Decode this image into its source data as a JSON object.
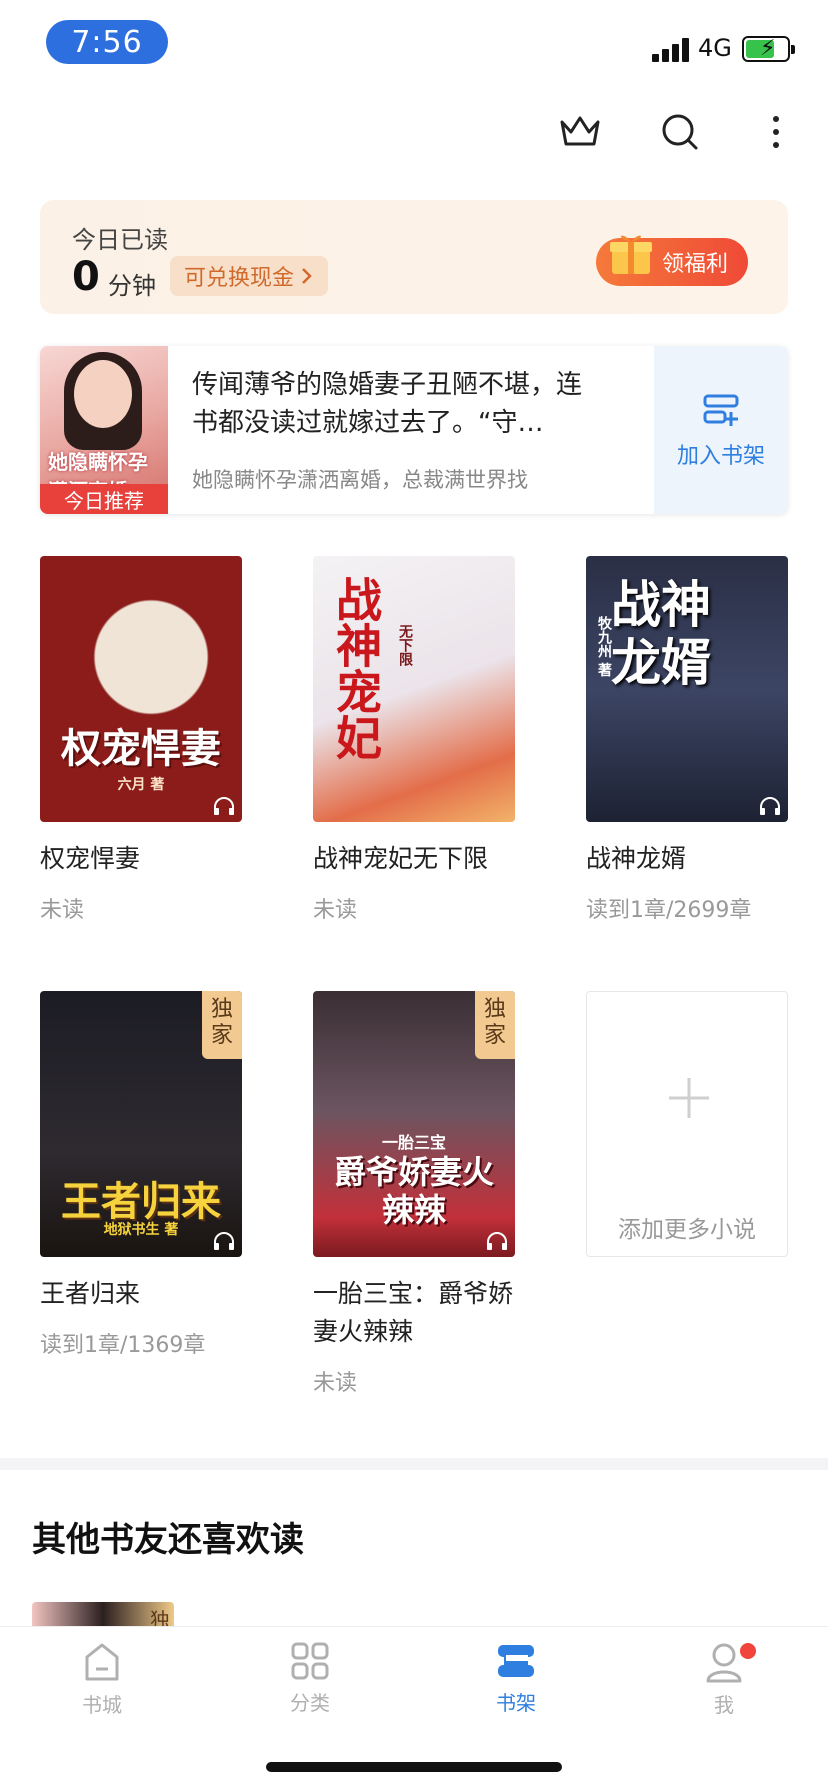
{
  "status": {
    "time": "7:56",
    "network": "4G"
  },
  "toolbar": {
    "icons": [
      "crown-icon",
      "search-icon",
      "more-icon"
    ]
  },
  "reading": {
    "label": "今日已读",
    "minutes": "0",
    "unit": "分钟",
    "cash_link": "可兑换现金",
    "welfare_button": "领福利"
  },
  "recommend": {
    "tag": "今日推荐",
    "cover_title": "她隐瞒怀孕 潇洒离婚",
    "text": "传闻薄爷的隐婚妻子丑陋不堪，连书都没读过就嫁过去了。“守…",
    "subtitle": "她隐瞒怀孕潇洒离婚，总裁满世界找",
    "add_label": "加入书架"
  },
  "books": [
    {
      "title": "权宠悍妻",
      "progress": "未读",
      "cover_text": "权宠悍妻",
      "author_tag": "六月 著"
    },
    {
      "title": "战神宠妃无下限",
      "progress": "未读",
      "cover_text": "战神宠妃",
      "author_tag": "无下限"
    },
    {
      "title": "战神龙婿",
      "progress": "读到1章/2699章",
      "cover_text": "战神龙婿",
      "author_tag": "牧九州 著"
    },
    {
      "title": "王者归来",
      "progress": "读到1章/1369章",
      "cover_text": "王者归来",
      "author_tag": "地狱书生 著",
      "exclusive": "独家"
    },
    {
      "title": "一胎三宝：爵爷娇妻火辣辣",
      "progress": "未读",
      "cover_text": "爵爷娇妻火辣辣",
      "author_tag": "一胎三宝",
      "exclusive": "独家"
    }
  ],
  "add_more": {
    "label": "添加更多小说"
  },
  "section": {
    "title": "其他书友还喜欢读",
    "peek_tag": "独"
  },
  "tabs": [
    {
      "label": "书城",
      "icon": "home-icon"
    },
    {
      "label": "分类",
      "icon": "grid-icon"
    },
    {
      "label": "书架",
      "icon": "bookshelf-icon",
      "active": true
    },
    {
      "label": "我",
      "icon": "user-icon"
    }
  ]
}
